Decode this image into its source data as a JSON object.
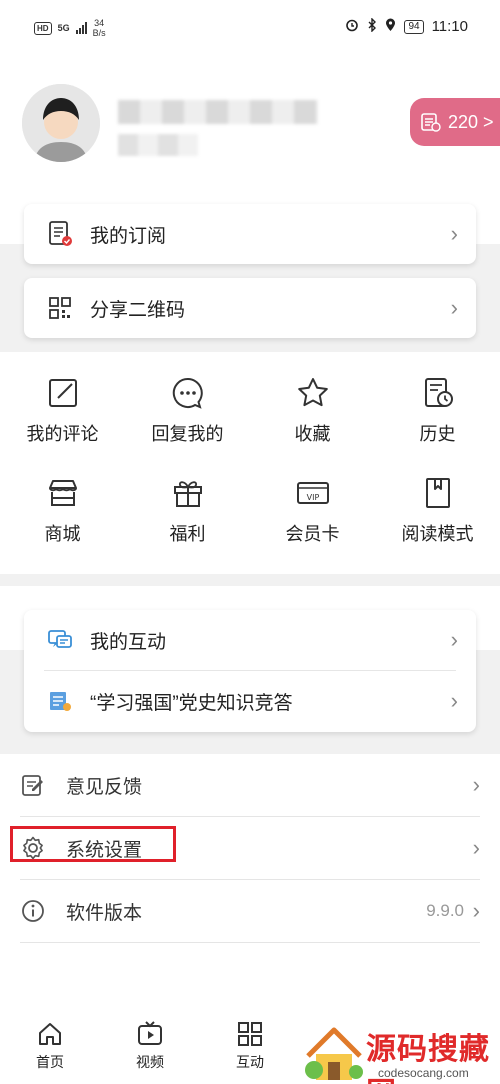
{
  "status_bar": {
    "hd": "HD",
    "network": "5G",
    "speed_value": "34",
    "speed_unit": "B/s",
    "battery": "94",
    "time": "11:10"
  },
  "profile": {
    "points": "220 >"
  },
  "cards_top": [
    {
      "label": "我的订阅",
      "icon": "subscription-icon"
    },
    {
      "label": "分享二维码",
      "icon": "qr-code-icon"
    }
  ],
  "grid": [
    {
      "label": "我的评论",
      "icon": "edit-icon"
    },
    {
      "label": "回复我的",
      "icon": "chat-bubble-icon"
    },
    {
      "label": "收藏",
      "icon": "star-icon"
    },
    {
      "label": "历史",
      "icon": "history-icon"
    },
    {
      "label": "商城",
      "icon": "store-icon"
    },
    {
      "label": "福利",
      "icon": "gift-icon"
    },
    {
      "label": "会员卡",
      "icon": "vip-card-icon"
    },
    {
      "label": "阅读模式",
      "icon": "bookmark-icon"
    }
  ],
  "cards_mid": [
    {
      "label": "我的互动",
      "icon": "interaction-icon"
    },
    {
      "label": "“学习强国”党史知识竞答",
      "icon": "quiz-icon"
    }
  ],
  "list": [
    {
      "label": "意见反馈",
      "icon": "feedback-icon"
    },
    {
      "label": "系统设置",
      "icon": "settings-gear-icon"
    },
    {
      "label": "软件版本",
      "icon": "info-icon",
      "version": "9.9.0"
    }
  ],
  "tabs": [
    {
      "label": "首页",
      "icon": "home-icon"
    },
    {
      "label": "视频",
      "icon": "video-icon"
    },
    {
      "label": "互动",
      "icon": "grid-icon"
    }
  ],
  "watermark": {
    "title": "源码搜藏网",
    "url": "codesocang.com"
  },
  "colors": {
    "accent_pink": "#e06b88",
    "highlight_red": "#e0202a",
    "subscription_red": "#e03a3a",
    "interaction_blue": "#3a8fd6"
  }
}
